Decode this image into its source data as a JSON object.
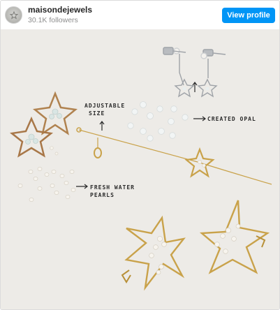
{
  "header": {
    "username": "maisondejewels",
    "followers": "30.1K followers",
    "view_profile_label": "View profile"
  },
  "avatar": {
    "icon": "jewelry-logo-icon"
  },
  "photo": {
    "subject": "star-earrings-flatlay",
    "notes": {
      "adjustable_line1": "ADJUSTABLE",
      "adjustable_line2": "SIZE",
      "opal": "CREATED OPAL",
      "pearls_line1": "FRESH WATER",
      "pearls_line2": "PEARLS"
    }
  },
  "colors": {
    "accent": "#0095f6",
    "gold": "#c9a24a",
    "silver": "#b9bcc0",
    "background": "#edebe7"
  }
}
